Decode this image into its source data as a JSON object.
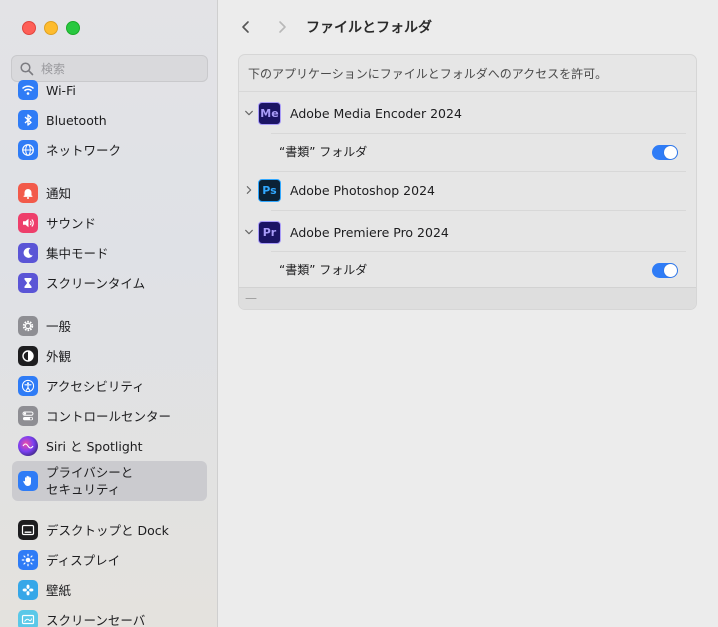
{
  "window": {
    "title": "ファイルとフォルダ"
  },
  "search": {
    "placeholder": "検索"
  },
  "sidebar": {
    "items": [
      {
        "id": "wifi",
        "label": "Wi-Fi",
        "icon": "wifi-icon",
        "color": "#2f7cf6"
      },
      {
        "id": "bluetooth",
        "label": "Bluetooth",
        "icon": "bluetooth-icon",
        "color": "#2f7cf6"
      },
      {
        "id": "network",
        "label": "ネットワーク",
        "icon": "globe-icon",
        "color": "#2f7cf6"
      },
      {
        "id": "notifications",
        "label": "通知",
        "icon": "bell-icon",
        "color": "#f25a4a"
      },
      {
        "id": "sound",
        "label": "サウンド",
        "icon": "speaker-icon",
        "color": "#ee3f6b"
      },
      {
        "id": "focus",
        "label": "集中モード",
        "icon": "moon-icon",
        "color": "#5b55d6"
      },
      {
        "id": "screentime",
        "label": "スクリーンタイム",
        "icon": "hourglass-icon",
        "color": "#5b55d6"
      },
      {
        "id": "general",
        "label": "一般",
        "icon": "gear-icon",
        "color": "#8e8e93"
      },
      {
        "id": "appearance",
        "label": "外観",
        "icon": "appearance-icon",
        "color": "#1d1d1f"
      },
      {
        "id": "accessibility",
        "label": "アクセシビリティ",
        "icon": "accessibility-icon",
        "color": "#2f7cf6"
      },
      {
        "id": "controlcenter",
        "label": "コントロールセンター",
        "icon": "toggles-icon",
        "color": "#8e8e93"
      },
      {
        "id": "siri",
        "label": "Siri と Spotlight",
        "icon": "siri-icon",
        "color": "#3a2d6e"
      },
      {
        "id": "privacy",
        "label": "プライバシーと\nセキュリティ",
        "icon": "hand-icon",
        "color": "#2f7cf6",
        "selected": true
      },
      {
        "id": "desktop",
        "label": "デスクトップと Dock",
        "icon": "dock-icon",
        "color": "#1d1d1f"
      },
      {
        "id": "displays",
        "label": "ディスプレイ",
        "icon": "sun-icon",
        "color": "#2f7cf6"
      },
      {
        "id": "wallpaper",
        "label": "壁紙",
        "icon": "flower-icon",
        "color": "#36a7e8"
      },
      {
        "id": "screensaver",
        "label": "スクリーンセーバ",
        "icon": "screensaver-icon",
        "color": "#5ac8e8"
      }
    ]
  },
  "main": {
    "description": "下のアプリケーションにファイルとフォルダへのアクセスを許可。",
    "apps": [
      {
        "name": "Adobe Media Encoder 2024",
        "icon_text": "Me",
        "icon_bg": "#1b1464",
        "icon_fg": "#a99cf8",
        "expanded": true,
        "permissions": [
          {
            "label": "“書類” フォルダ",
            "enabled": true
          }
        ]
      },
      {
        "name": "Adobe Photoshop 2024",
        "icon_text": "Ps",
        "icon_bg": "#0b2236",
        "icon_fg": "#31a8ff",
        "expanded": false,
        "permissions": []
      },
      {
        "name": "Adobe Premiere Pro 2024",
        "icon_text": "Pr",
        "icon_bg": "#1b1464",
        "icon_fg": "#a99cf8",
        "expanded": true,
        "permissions": [
          {
            "label": "“書類” フォルダ",
            "enabled": true
          }
        ]
      }
    ],
    "footer": {
      "remove_label": "—"
    }
  }
}
